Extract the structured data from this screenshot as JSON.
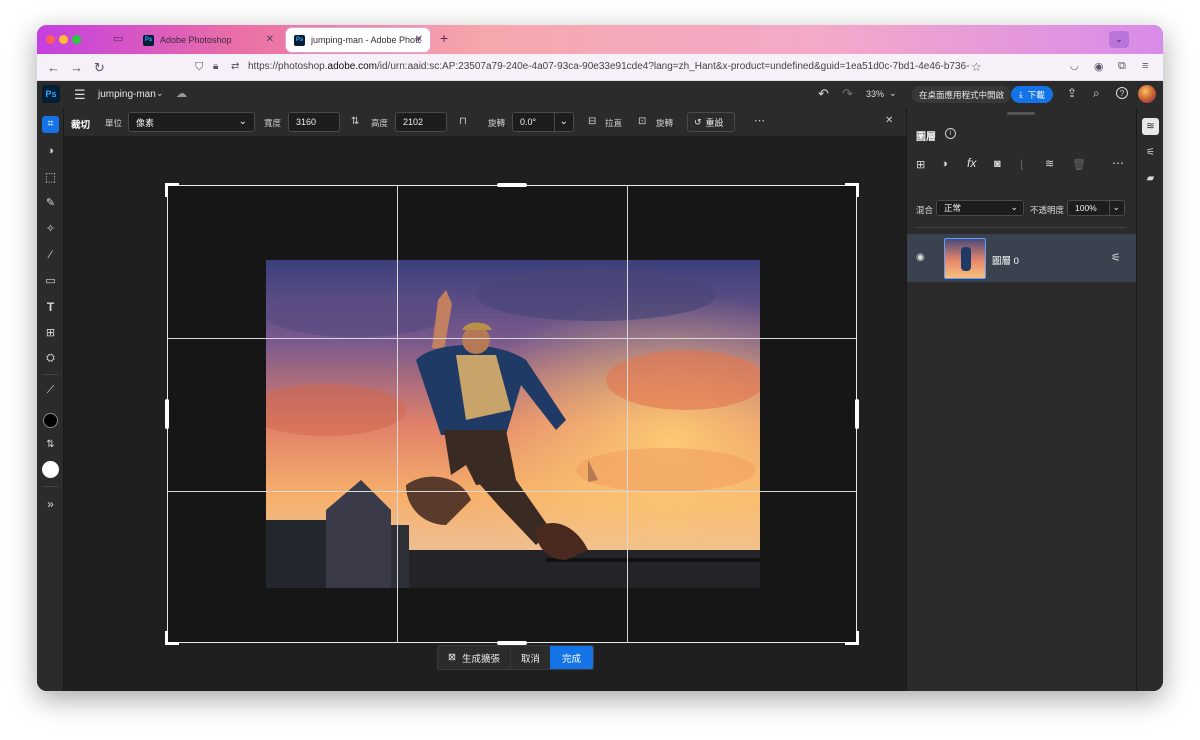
{
  "browser": {
    "tabs": [
      {
        "label": "Adobe Photoshop"
      },
      {
        "label": "jumping-man - Adobe Photosho"
      }
    ],
    "url_prefix": "https://photoshop.",
    "url_domain": "adobe.com",
    "url_rest": "/id/urn:aaid:sc:AP:23507a79-240e-4a07-93ca-90e33e91cde4?lang=zh_Hant&x-product=undefined&guid=1ea51d0c-7bd1-4e46-b736-9683"
  },
  "app": {
    "logo": "Ps",
    "doc_name": "jumping-man",
    "zoom": "33%",
    "open_in_desktop": "在桌面應用程式中開啟",
    "download": "下載"
  },
  "options": {
    "tool_name": "裁切",
    "unit_label": "單位",
    "unit_value": "像素",
    "width_label": "寬度",
    "width_value": "3160",
    "height_label": "高度",
    "height_value": "2102",
    "rotate_label": "旋轉",
    "rotate_value": "0.0°",
    "straighten": "拉直",
    "rotate_btn": "旋轉",
    "reset": "重設"
  },
  "crop_actions": {
    "generative_expand": "生成擴張",
    "cancel": "取消",
    "done": "完成"
  },
  "layers_panel": {
    "title": "圖層",
    "blend_label": "混合",
    "blend_value": "正常",
    "opacity_label": "不透明度",
    "opacity_value": "100%",
    "layers": [
      {
        "name": "圖層 0"
      }
    ]
  },
  "colors": {
    "accent": "#1473e6",
    "ps_blue": "#31a8ff"
  }
}
